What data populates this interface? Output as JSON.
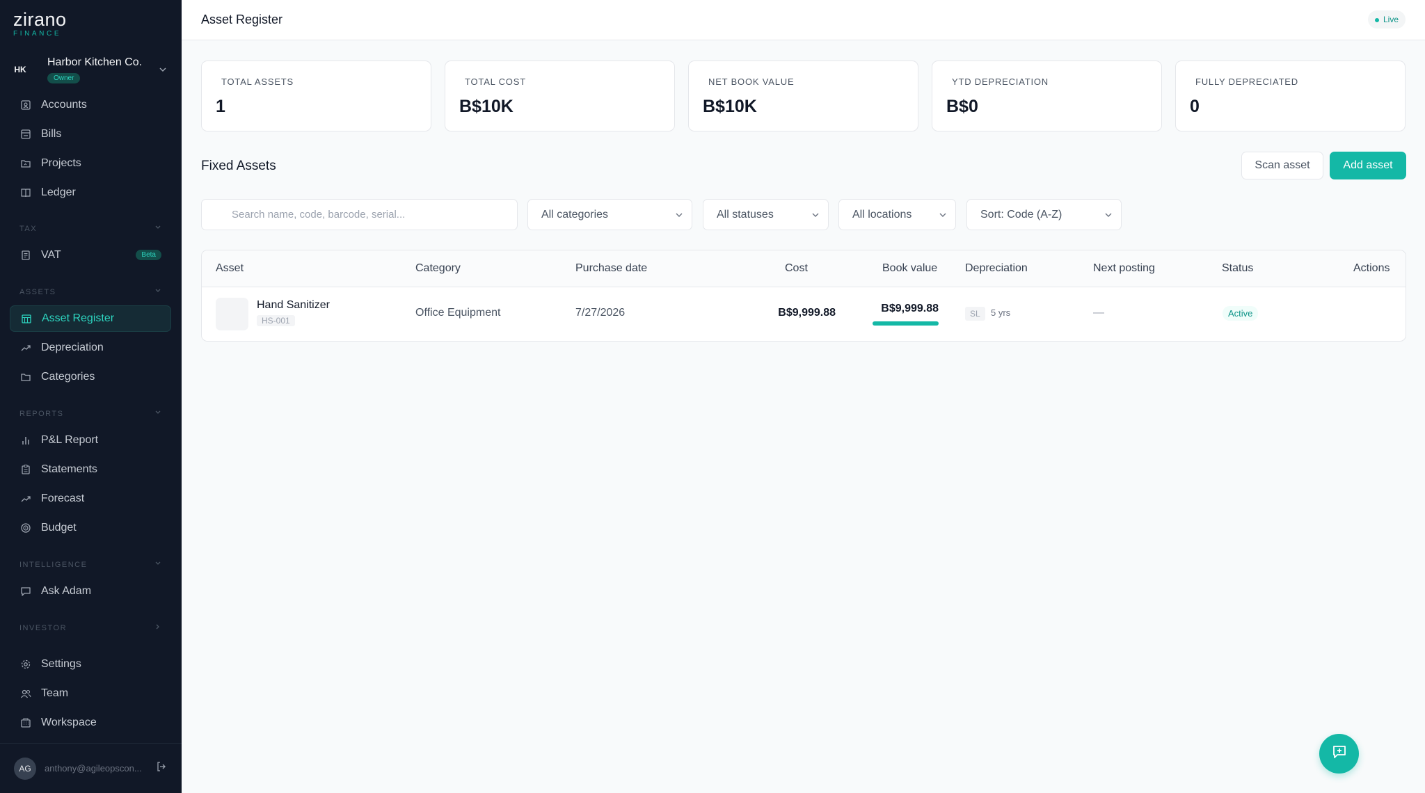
{
  "brand": {
    "name": "zirano",
    "sub": "FINANCE"
  },
  "org": {
    "initials": "HK",
    "name": "Harbor Kitchen Co.",
    "role": "Owner"
  },
  "nav": {
    "main": [
      {
        "label": "Accounts",
        "icon": "accounts-icon"
      },
      {
        "label": "Bills",
        "icon": "bills-icon"
      },
      {
        "label": "Projects",
        "icon": "projects-icon"
      },
      {
        "label": "Ledger",
        "icon": "ledger-icon"
      }
    ],
    "tax_section": "TAX",
    "tax": [
      {
        "label": "VAT",
        "badge": "Beta",
        "icon": "vat-icon"
      }
    ],
    "assets_section": "ASSETS",
    "assets": [
      {
        "label": "Asset Register",
        "icon": "asset-register-icon",
        "active": true
      },
      {
        "label": "Depreciation",
        "icon": "depreciation-icon"
      },
      {
        "label": "Categories",
        "icon": "categories-icon"
      }
    ],
    "reports_section": "REPORTS",
    "reports": [
      {
        "label": "P&L Report",
        "icon": "pl-report-icon"
      },
      {
        "label": "Statements",
        "icon": "statements-icon"
      },
      {
        "label": "Forecast",
        "icon": "forecast-icon"
      },
      {
        "label": "Budget",
        "icon": "budget-icon"
      }
    ],
    "intelligence_section": "INTELLIGENCE",
    "intelligence": [
      {
        "label": "Ask Adam",
        "icon": "chat-icon"
      }
    ],
    "investor_section": "INVESTOR",
    "bottom": [
      {
        "label": "Settings",
        "icon": "gear-icon"
      },
      {
        "label": "Team",
        "icon": "team-icon"
      },
      {
        "label": "Workspace",
        "icon": "workspace-icon"
      }
    ]
  },
  "user": {
    "initials": "AG",
    "email": "anthony@agileopscon..."
  },
  "header": {
    "title": "Asset Register",
    "status": "Live"
  },
  "stats": [
    {
      "label": "TOTAL ASSETS",
      "value": "1"
    },
    {
      "label": "TOTAL COST",
      "value": "B$10K"
    },
    {
      "label": "NET BOOK VALUE",
      "value": "B$10K"
    },
    {
      "label": "YTD DEPRECIATION",
      "value": "B$0"
    },
    {
      "label": "FULLY DEPRECIATED",
      "value": "0"
    }
  ],
  "section": {
    "title": "Fixed Assets",
    "scan_label": "Scan asset",
    "add_label": "Add asset"
  },
  "filters": {
    "search_placeholder": "Search name, code, barcode, serial...",
    "category": "All categories",
    "status": "All statuses",
    "location": "All locations",
    "sort": "Sort: Code (A-Z)"
  },
  "table": {
    "headers": [
      "Asset",
      "Category",
      "Purchase date",
      "Cost",
      "Book value",
      "Depreciation",
      "Next posting",
      "Status",
      "Actions"
    ],
    "rows": [
      {
        "name": "Hand Sanitizer",
        "code": "HS-001",
        "category": "Office Equipment",
        "purchase_date": "7/27/2026",
        "cost": "B$9,999.88",
        "book_value": "B$9,999.88",
        "book_value_fraction": 1.0,
        "method": "SL",
        "life": "5 yrs",
        "next_posting": "—",
        "status": "Active"
      }
    ]
  },
  "colors": {
    "accent": "#14b8a6",
    "sidebar": "#111827"
  }
}
